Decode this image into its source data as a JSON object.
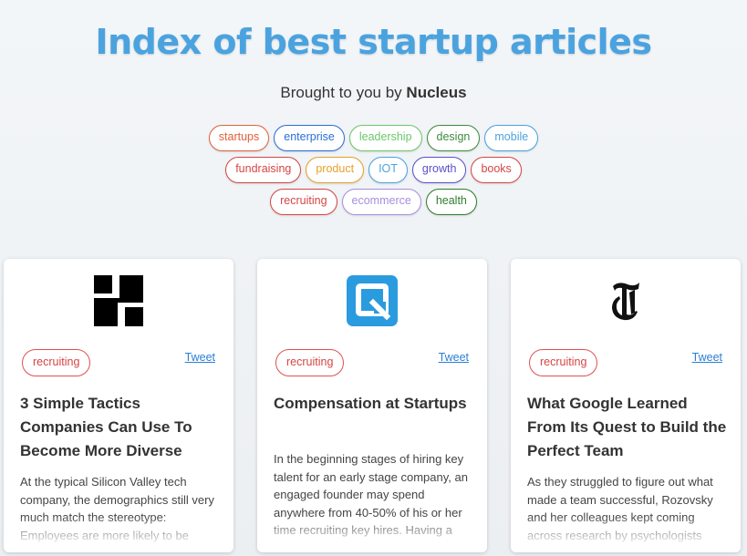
{
  "header": {
    "title": "Index of best startup articles",
    "subtitle_prefix": "Brought to you by",
    "subtitle_brand": "Nucleus"
  },
  "tags": [
    [
      {
        "label": "startups",
        "color": "#e0623a"
      },
      {
        "label": "enterprise",
        "color": "#2a6fd4"
      },
      {
        "label": "leadership",
        "color": "#6cc76c"
      },
      {
        "label": "design",
        "color": "#3e8a3e"
      },
      {
        "label": "mobile",
        "color": "#4aa3df"
      }
    ],
    [
      {
        "label": "fundraising",
        "color": "#d64545"
      },
      {
        "label": "product",
        "color": "#e8a02a"
      },
      {
        "label": "IOT",
        "color": "#4aa3df"
      },
      {
        "label": "growth",
        "color": "#5a4fc9"
      },
      {
        "label": "books",
        "color": "#d64545"
      }
    ],
    [
      {
        "label": "recruiting",
        "color": "#d64545"
      },
      {
        "label": "ecommerce",
        "color": "#a98ee0"
      },
      {
        "label": "health",
        "color": "#2e7d2e"
      }
    ]
  ],
  "articles": [
    {
      "logo": "hackerrank-logo",
      "tag": "recruiting",
      "tweet": "Tweet",
      "title": "3 Simple Tactics Companies Can Use To Become More Diverse",
      "body": "At the typical Silicon Valley tech company, the demographics still very much match the stereotype: Employees are more likely to be"
    },
    {
      "logo": "qbox-logo",
      "tag": "recruiting",
      "tweet": "Tweet",
      "title": "Compensation at Startups",
      "body": "In the beginning stages of hiring key talent for an early stage company, an engaged founder may spend anywhere from 40-50% of his or her time recruiting key hires. Having a"
    },
    {
      "logo": "nytimes-logo",
      "tag": "recruiting",
      "tweet": "Tweet",
      "title": "What Google Learned From Its Quest to Build the Perfect Team",
      "body": "As they struggled to figure out what made a team successful, Rozovsky and her colleagues kept coming across research by psychologists"
    }
  ]
}
